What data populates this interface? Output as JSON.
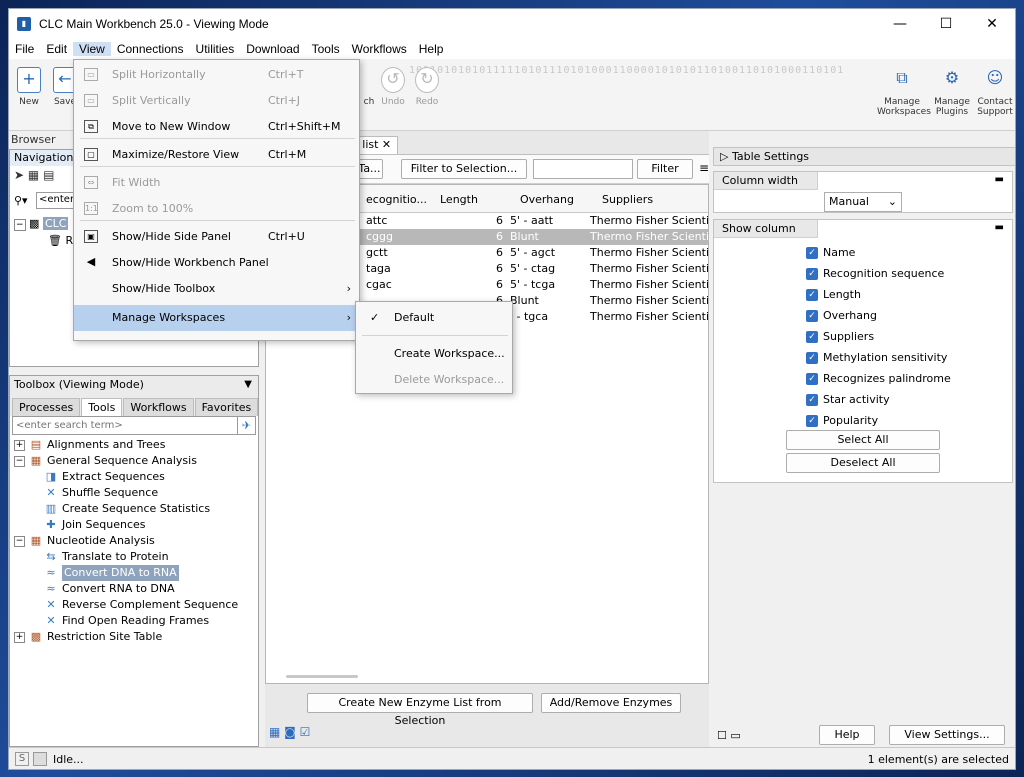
{
  "window": {
    "title": "CLC Main Workbench 25.0 - Viewing Mode",
    "min": "—",
    "max": "☐",
    "close": "✕"
  },
  "menubar": [
    "File",
    "Edit",
    "View",
    "Connections",
    "Utilities",
    "Download",
    "Tools",
    "Workflows",
    "Help"
  ],
  "toolbar": {
    "new": "New",
    "save": "Save",
    "search": "ch",
    "undo": "Undo",
    "redo": "Redo",
    "manage_workspaces_1": "Manage",
    "manage_workspaces_2": "Workspaces",
    "manage_plugins_1": "Manage",
    "manage_plugins_2": "Plugins",
    "contact_1": "Contact",
    "contact_2": "Support",
    "bits": "10110101010111110101110101000110000101010110100110101000110101"
  },
  "left": {
    "browser_label": "Browser",
    "nav_title": "Navigation",
    "nav_search": "<enter",
    "nav_root": "CLC",
    "nav_child": "R"
  },
  "toolbox": {
    "title": "Toolbox (Viewing Mode)",
    "tabs": [
      "Processes",
      "Tools",
      "Workflows",
      "Favorites"
    ],
    "search_placeholder": "<enter search term>",
    "tree": [
      {
        "level": 0,
        "exp": "+",
        "label": "Alignments and Trees"
      },
      {
        "level": 0,
        "exp": "−",
        "label": "General Sequence Analysis"
      },
      {
        "level": 1,
        "label": "Extract Sequences"
      },
      {
        "level": 1,
        "label": "Shuffle Sequence"
      },
      {
        "level": 1,
        "label": "Create Sequence Statistics"
      },
      {
        "level": 1,
        "label": "Join Sequences"
      },
      {
        "level": 0,
        "exp": "−",
        "label": "Nucleotide Analysis"
      },
      {
        "level": 1,
        "label": "Translate to Protein"
      },
      {
        "level": 1,
        "label": "Convert DNA to RNA",
        "selected": true
      },
      {
        "level": 1,
        "label": "Convert RNA to DNA"
      },
      {
        "level": 1,
        "label": "Reverse Complement Sequence"
      },
      {
        "level": 1,
        "label": "Find Open Reading Frames"
      },
      {
        "level": 0,
        "exp": "+",
        "label": "Restriction Site Table"
      }
    ]
  },
  "center": {
    "tab_label": "e list",
    "tab_close": "✕",
    "btn_table": "Ta...",
    "btn_filter_selection": "Filter to Selection...",
    "btn_filter": "Filter",
    "columns": [
      "ecognitio...",
      "Length",
      "Overhang",
      "Suppliers"
    ],
    "rows": [
      {
        "rec": "attc",
        "len": "6",
        "over": "5' - aatt",
        "sup": "Thermo Fisher Scientific"
      },
      {
        "rec": "cggg",
        "len": "6",
        "over": "Blunt",
        "sup": "Thermo Fisher Scientific",
        "selected": true
      },
      {
        "rec": "gctt",
        "len": "6",
        "over": "5' - agct",
        "sup": "Thermo Fisher Scientific"
      },
      {
        "rec": "taga",
        "len": "6",
        "over": "5' - ctag",
        "sup": "Thermo Fisher Scientific"
      },
      {
        "rec": "cgac",
        "len": "6",
        "over": "5' - tcga",
        "sup": "Thermo Fisher Scientific"
      },
      {
        "rec": "",
        "len": "6",
        "over": "Blunt",
        "sup": "Thermo Fisher Scientific"
      },
      {
        "rec": "",
        "len": "",
        "over": "' - tgca",
        "sup": "Thermo Fisher Scientific"
      }
    ],
    "btn_create_list": "Create New Enzyme List from Selection",
    "btn_add_remove": "Add/Remove Enzymes"
  },
  "right": {
    "header": "Table Settings",
    "column_width_title": "Column width",
    "column_width_value": "Manual",
    "show_column_title": "Show column",
    "columns": [
      "Name",
      "Recognition sequence",
      "Length",
      "Overhang",
      "Suppliers",
      "Methylation sensitivity",
      "Recognizes palindrome",
      "Star activity",
      "Popularity"
    ],
    "select_all": "Select All",
    "deselect_all": "Deselect All",
    "help": "Help",
    "view_settings": "View Settings..."
  },
  "menu": {
    "items": [
      {
        "label": "Split Horizontally",
        "shortcut": "Ctrl+T",
        "disabled": true
      },
      {
        "label": "Split Vertically",
        "shortcut": "Ctrl+J",
        "disabled": true
      },
      {
        "label": "Move to New Window",
        "shortcut": "Ctrl+Shift+M"
      },
      {
        "label": "Maximize/Restore View",
        "shortcut": "Ctrl+M"
      },
      {
        "label": "Fit Width",
        "shortcut": "",
        "disabled": true
      },
      {
        "label": "Zoom to 100%",
        "shortcut": "",
        "disabled": true
      },
      {
        "label": "Show/Hide Side Panel",
        "shortcut": "Ctrl+U"
      },
      {
        "label": "Show/Hide Workbench Panel",
        "shortcut": ""
      },
      {
        "label": "Show/Hide Toolbox",
        "shortcut": "",
        "submenu": true
      },
      {
        "label": "Manage Workspaces",
        "shortcut": "",
        "submenu": true,
        "hover": true
      }
    ],
    "sub": [
      {
        "label": "Default",
        "checked": true
      },
      {
        "label": "Create Workspace..."
      },
      {
        "label": "Delete Workspace...",
        "disabled": true
      }
    ]
  },
  "status": {
    "state": "Idle...",
    "selected": "1 element(s) are selected"
  },
  "colors": {
    "accent": "#2f6fc4",
    "menu_hover": "#b7d0ee",
    "selection": "#b8b8b8"
  }
}
